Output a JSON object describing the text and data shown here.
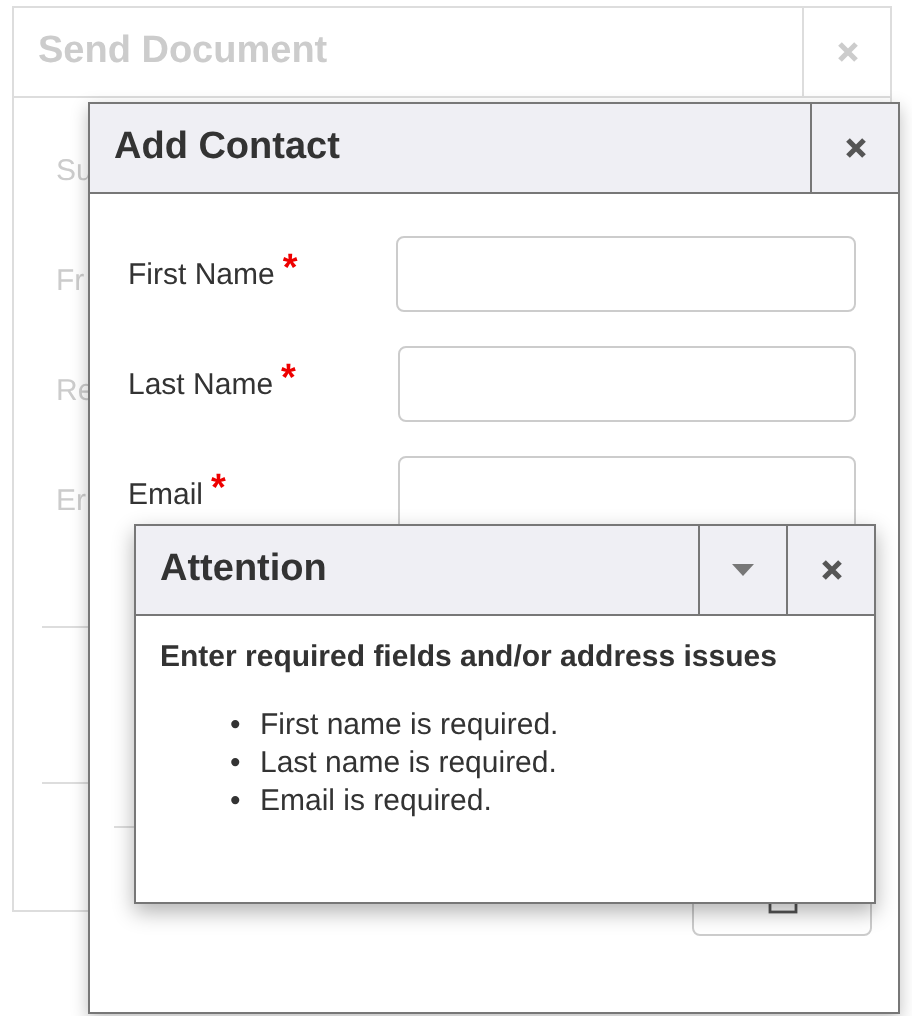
{
  "background_window": {
    "title": "Send Document",
    "labels": [
      "Su",
      "Fr",
      "Re",
      "Er"
    ]
  },
  "add_contact": {
    "title": "Add Contact",
    "fields": [
      {
        "label": "First Name",
        "required": true,
        "marker": "*"
      },
      {
        "label": "Last Name",
        "required": true,
        "marker": "*"
      },
      {
        "label": "Email",
        "required": true,
        "marker": "*"
      }
    ]
  },
  "attention": {
    "title": "Attention",
    "heading": "Enter required fields and/or address issues",
    "messages": [
      {
        "bullet": "•",
        "text": "First name is required."
      },
      {
        "bullet": "•",
        "text": "Last name is required."
      },
      {
        "bullet": "•",
        "text": "Email is required."
      }
    ]
  }
}
